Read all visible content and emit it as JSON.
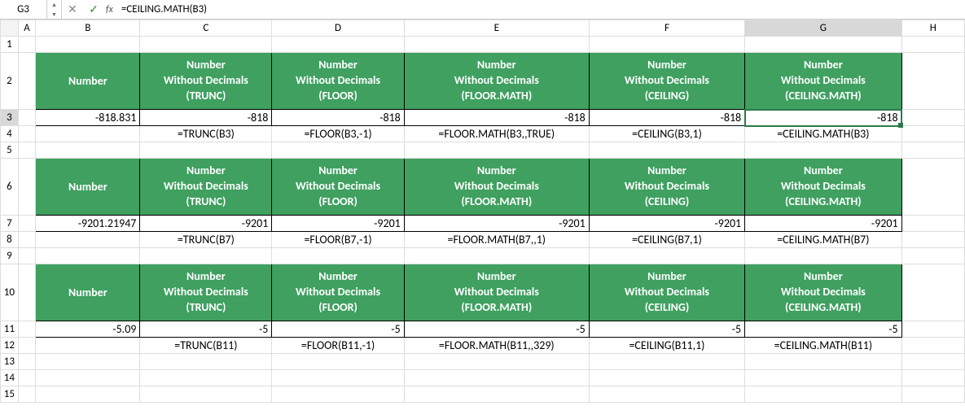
{
  "name_box": "G3",
  "formula": "=CEILING.MATH(B3)",
  "fx_label": "fx",
  "columns": [
    "A",
    "B",
    "C",
    "D",
    "E",
    "F",
    "G",
    "H"
  ],
  "rows": [
    "1",
    "2",
    "3",
    "4",
    "5",
    "6",
    "7",
    "8",
    "9",
    "10",
    "11",
    "12",
    "13",
    "14",
    "15"
  ],
  "hdr": {
    "number": "Number",
    "line1": "Number",
    "line2": "Without Decimals",
    "trunc": "(TRUNC)",
    "floor": "(FLOOR)",
    "floormath": "(FLOOR.MATH)",
    "ceiling": "(CEILING)",
    "ceilingmath": "(CEILING.MATH)"
  },
  "blocks": [
    {
      "input": "-818.831",
      "vals": [
        "-818",
        "-818",
        "-818",
        "-818",
        "-818"
      ],
      "formulas": [
        "=TRUNC(B3)",
        "=FLOOR(B3,-1)",
        "=FLOOR.MATH(B3,,TRUE)",
        "=CEILING(B3,1)",
        "=CEILING.MATH(B3)"
      ]
    },
    {
      "input": "-9201.21947",
      "vals": [
        "-9201",
        "-9201",
        "-9201",
        "-9201",
        "-9201"
      ],
      "formulas": [
        "=TRUNC(B7)",
        "=FLOOR(B7,-1)",
        "=FLOOR.MATH(B7,,1)",
        "=CEILING(B7,1)",
        "=CEILING.MATH(B7)"
      ]
    },
    {
      "input": "-5.09",
      "vals": [
        "-5",
        "-5",
        "-5",
        "-5",
        "-5"
      ],
      "formulas": [
        "=TRUNC(B11)",
        "=FLOOR(B11,-1)",
        "=FLOOR.MATH(B11,,329)",
        "=CEILING(B11,1)",
        "=CEILING.MATH(B11)"
      ]
    }
  ],
  "selected": {
    "col": "G",
    "row": "3"
  }
}
